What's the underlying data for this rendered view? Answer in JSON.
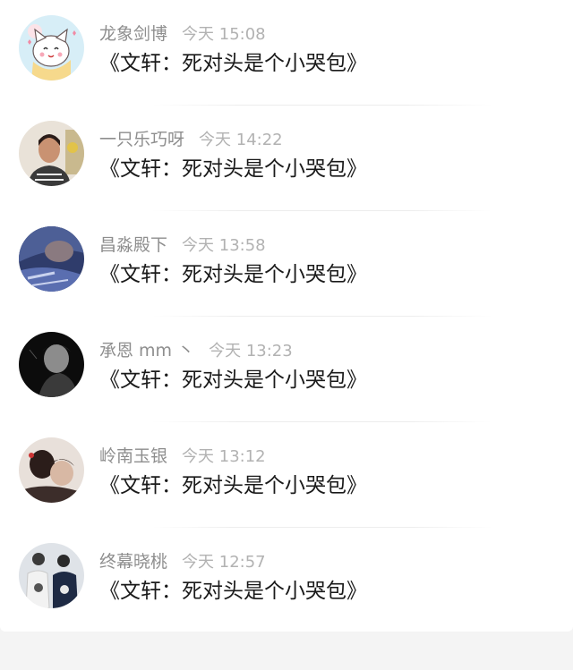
{
  "comments": [
    {
      "name": "龙象剑博",
      "time": "今天 15:08",
      "text": "《文轩：死对头是个小哭包》",
      "avatar_icon": "cartoon-cat-avatar"
    },
    {
      "name": "一只乐巧呀",
      "time": "今天 14:22",
      "text": "《文轩：死对头是个小哭包》",
      "avatar_icon": "woman-photo-avatar"
    },
    {
      "name": "昌淼殿下",
      "time": "今天 13:58",
      "text": "《文轩：死对头是个小哭包》",
      "avatar_icon": "blue-photo-avatar"
    },
    {
      "name": "承恩 mm 丶",
      "time": "今天 13:23",
      "text": "《文轩：死对头是个小哭包》",
      "avatar_icon": "dark-portrait-avatar"
    },
    {
      "name": "岭南玉银",
      "time": "今天 13:12",
      "text": "《文轩：死对头是个小哭包》",
      "avatar_icon": "couple-photo-avatar"
    },
    {
      "name": "终幕晓桃",
      "time": "今天 12:57",
      "text": "《文轩：死对头是个小哭包》",
      "avatar_icon": "couple-shirts-avatar"
    }
  ]
}
